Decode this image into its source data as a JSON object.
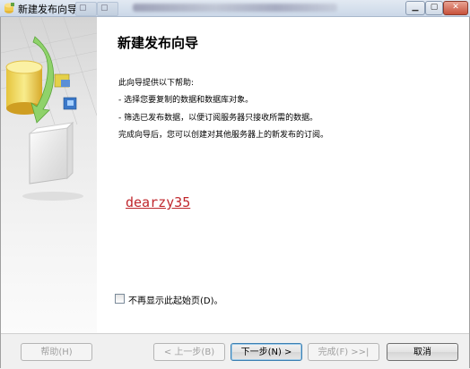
{
  "window": {
    "title": "新建发布向导"
  },
  "content": {
    "page_title": "新建发布向导",
    "intro": "此向导提供以下帮助:",
    "bullets": [
      "- 选择您要复制的数据和数据库对象。",
      "- 筛选已发布数据，以便订阅服务器只接收所需的数据。",
      "完成向导后，您可以创建对其他服务器上的新发布的订阅。"
    ],
    "watermark": "dearzy35",
    "checkbox_label": "不再显示此起始页(D)。"
  },
  "footer": {
    "help": "帮助(H)",
    "back": "< 上一步(B)",
    "next": "下一步(N) >",
    "finish": "完成(F) >>|",
    "cancel": "取消"
  }
}
